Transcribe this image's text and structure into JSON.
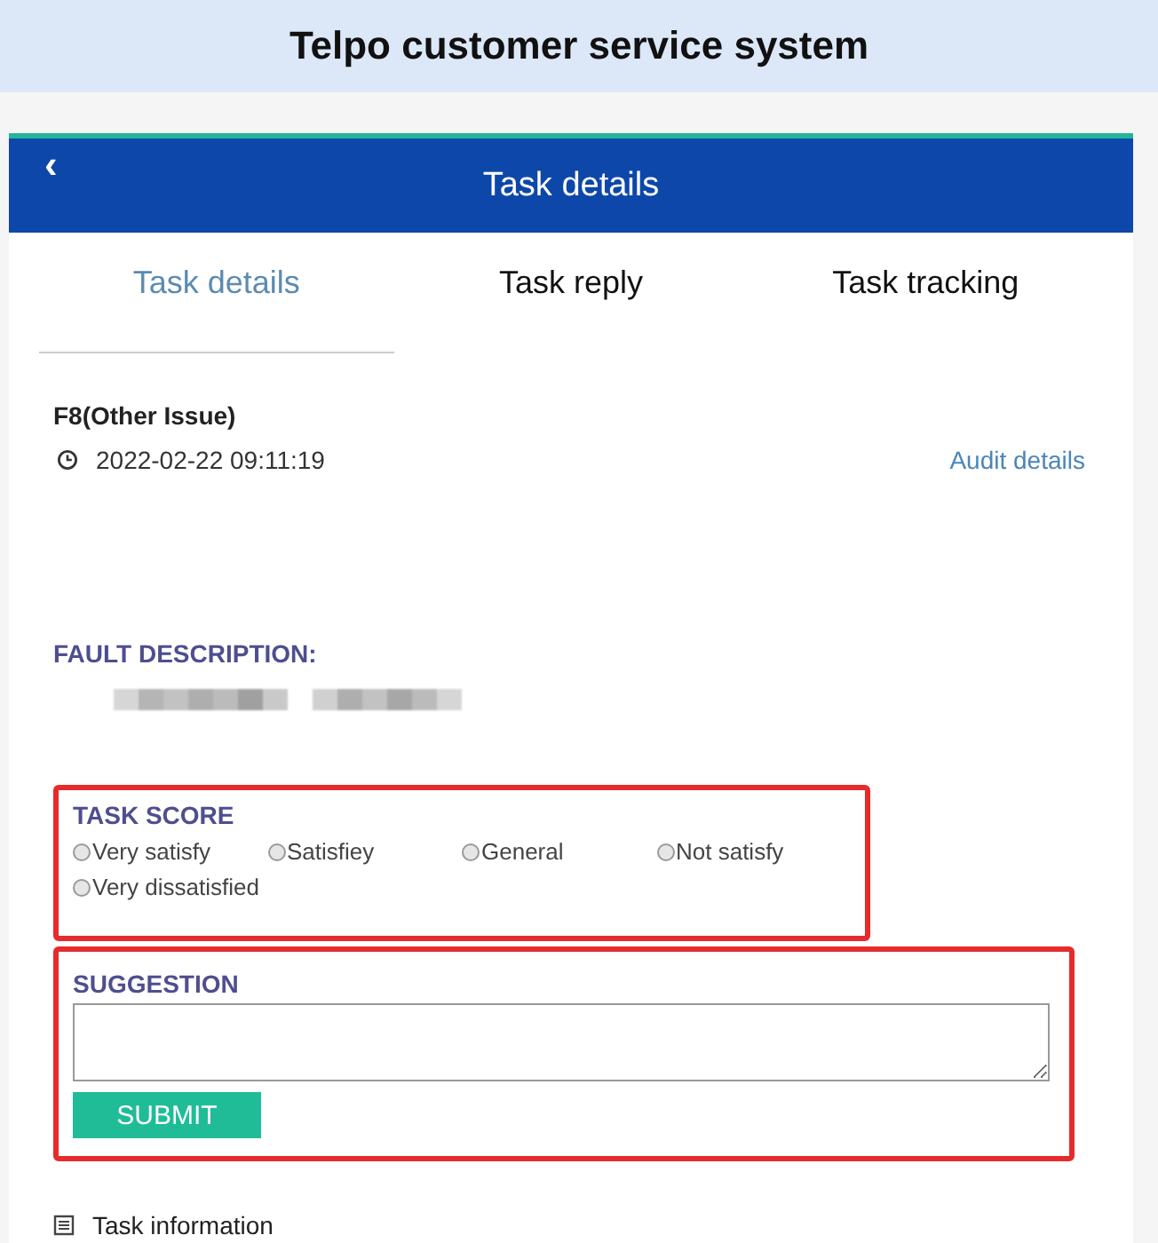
{
  "app_title": "Telpo customer service system",
  "nav_bar": {
    "back": "‹",
    "title": "Task details"
  },
  "tabs": [
    {
      "label": "Task details",
      "selected": true
    },
    {
      "label": "Task reply",
      "selected": false
    },
    {
      "label": "Task tracking",
      "selected": false
    }
  ],
  "task": {
    "name": "F8(Other Issue)",
    "time": "2022-02-22 09:11:19",
    "audit_link": "Audit details"
  },
  "fault_description": {
    "label": "FAULT DESCRIPTION:"
  },
  "task_score": {
    "label": "TASK SCORE",
    "highlighted": true,
    "options": [
      {
        "label": "Very satisfy",
        "selected": false
      },
      {
        "label": "Satisfiey",
        "selected": false
      },
      {
        "label": "General",
        "selected": false
      },
      {
        "label": "Not satisfy",
        "selected": false
      },
      {
        "label": "Very dissatisfied",
        "selected": false
      }
    ]
  },
  "suggestion": {
    "label": "SUGGESTION",
    "highlighted": true,
    "submit": "SUBMIT"
  },
  "task_information": {
    "label": "Task information"
  }
}
